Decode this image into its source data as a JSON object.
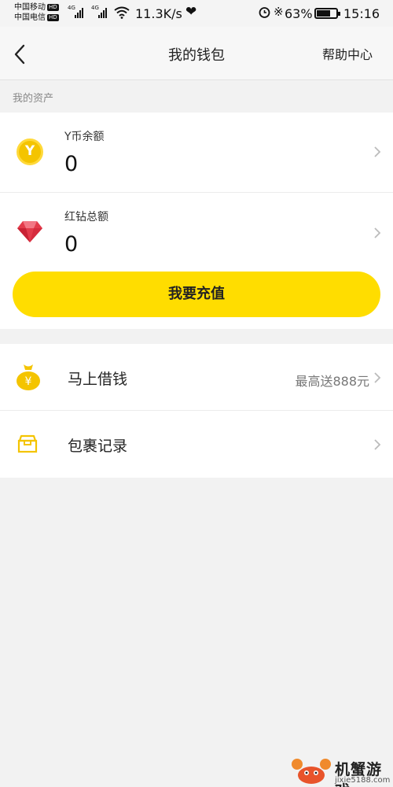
{
  "status_bar": {
    "carrier_1": "中国移动",
    "carrier_2": "中国电信",
    "hd_badge": "HD",
    "network": "4G",
    "speed": "11.3K/s",
    "battery": "63%",
    "time": "15:16"
  },
  "nav": {
    "back_icon": "chevron-left-icon",
    "title": "我的钱包",
    "help": "帮助中心"
  },
  "assets": {
    "section_label": "我的资产",
    "coin": {
      "icon": "y-coin-icon",
      "icon_glyph": "Y",
      "label": "Y币余额",
      "value": "0"
    },
    "diamond": {
      "icon": "red-diamond-icon",
      "label": "红钻总额",
      "value": "0"
    },
    "recharge_button": "我要充值"
  },
  "menu": [
    {
      "icon": "money-bag-icon",
      "icon_glyph": "¥",
      "label": "马上借钱",
      "extra": "最高送888元"
    },
    {
      "icon": "package-box-icon",
      "label": "包裹记录",
      "extra": ""
    }
  ],
  "watermark": {
    "text": "机蟹游戏",
    "url": "jixie5188.com"
  },
  "colors": {
    "accent_yellow": "#ffdd00",
    "coin_yellow": "#f4c400",
    "diamond_red": "#e33a4a",
    "background": "#f2f2f2"
  }
}
